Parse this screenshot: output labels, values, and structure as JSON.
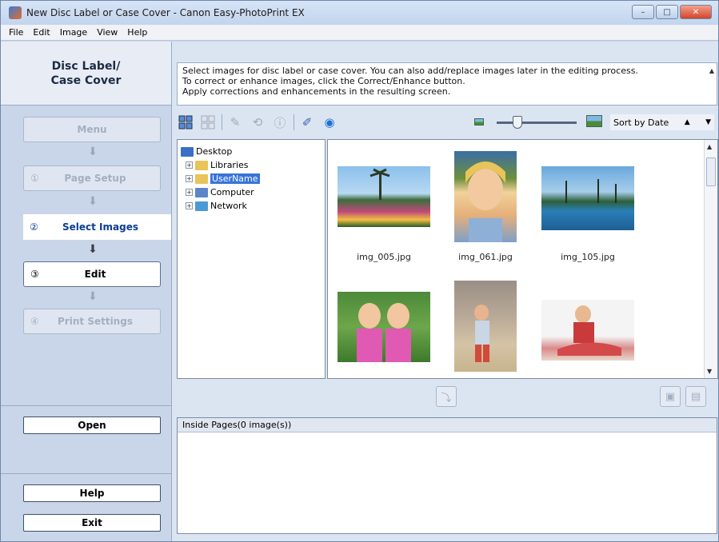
{
  "window": {
    "title": "New Disc Label or Case Cover - Canon Easy-PhotoPrint EX",
    "buttons": {
      "minimize": "–",
      "maximize": "□",
      "close": "✕"
    }
  },
  "menu": [
    "File",
    "Edit",
    "Image",
    "View",
    "Help"
  ],
  "left": {
    "header_line1": "Disc Label/",
    "header_line2": "Case Cover",
    "steps": {
      "menu": "Menu",
      "page_setup": {
        "num": "①",
        "label": "Page Setup"
      },
      "select_images": {
        "num": "②",
        "label": "Select Images"
      },
      "edit": {
        "num": "③",
        "label": "Edit"
      },
      "print_settings": {
        "num": "④",
        "label": "Print Settings"
      }
    },
    "open": "Open",
    "help": "Help",
    "exit": "Exit"
  },
  "instructions": [
    "Select images for disc label or case cover. You can also add/replace images later in the editing process.",
    "To correct or enhance images, click the Correct/Enhance button.",
    "Apply corrections and enhancements in the resulting screen."
  ],
  "toolbar": {
    "sort_label": "Sort by Date",
    "sort_dir_icon": "▲",
    "dropdown_icon": "▼"
  },
  "tree": {
    "desktop": "Desktop",
    "libraries": "Libraries",
    "username": "UserName",
    "computer": "Computer",
    "network": "Network"
  },
  "thumbnails": [
    "img_005.jpg",
    "img_061.jpg",
    "img_105.jpg"
  ],
  "inside_pages": {
    "header": "Inside Pages(0 image(s))"
  }
}
